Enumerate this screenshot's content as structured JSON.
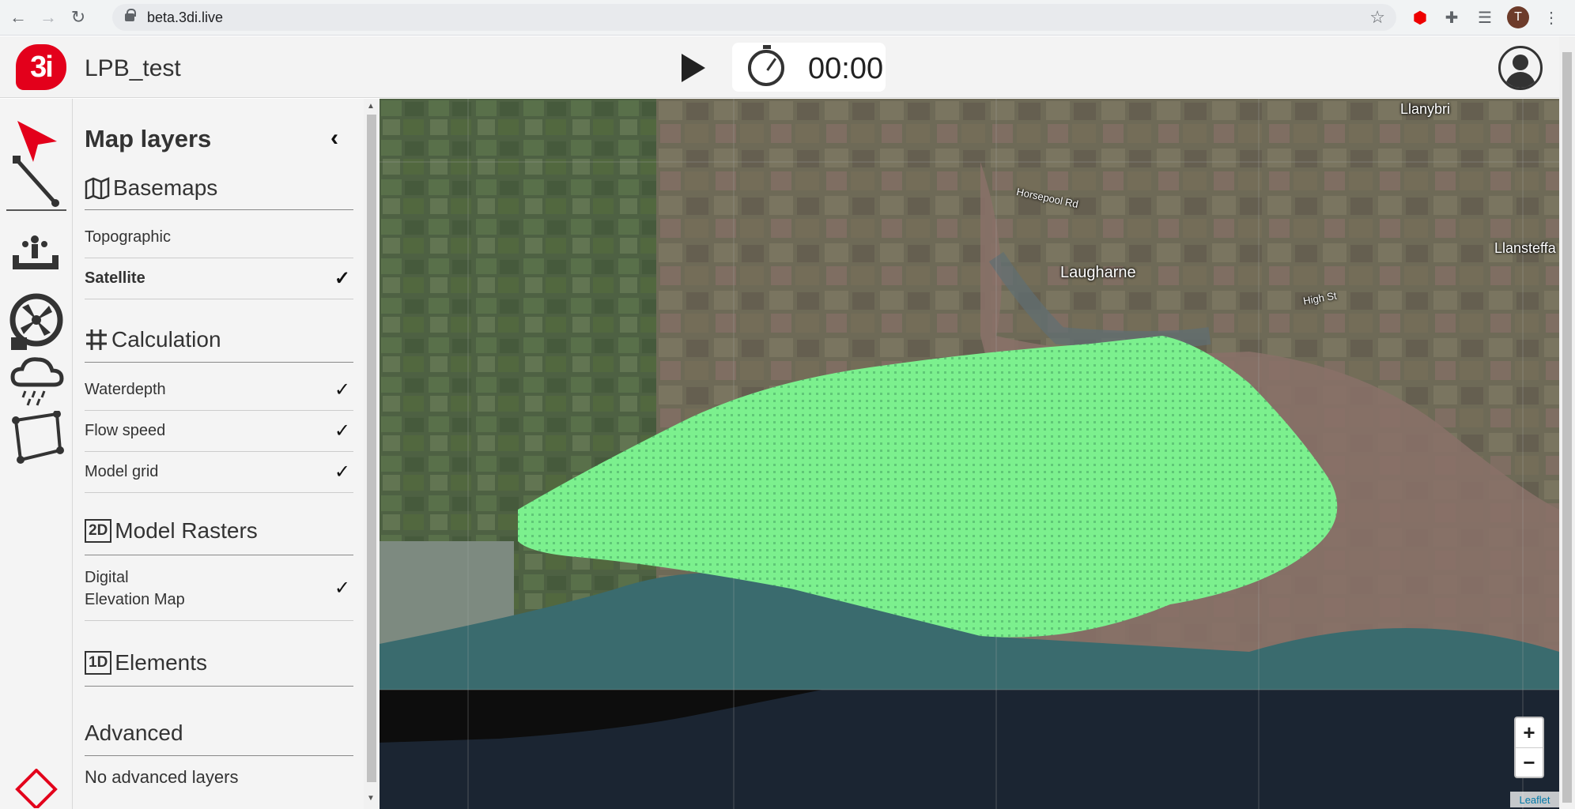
{
  "browser": {
    "url": "beta.3di.live",
    "profile_initial": "T"
  },
  "header": {
    "logo_text": "3i",
    "project_name": "LPB_test",
    "timer": "00:00"
  },
  "panel": {
    "title": "Map layers",
    "collapse_symbol": "‹",
    "sections": {
      "basemaps": {
        "title": "Basemaps",
        "items": [
          {
            "label": "Topographic",
            "checked": false
          },
          {
            "label": "Satellite",
            "checked": true
          }
        ]
      },
      "calculation": {
        "title": "Calculation",
        "items": [
          {
            "label": "Waterdepth",
            "checked": true
          },
          {
            "label": "Flow speed",
            "checked": true
          },
          {
            "label": "Model grid",
            "checked": true
          }
        ]
      },
      "model_rasters": {
        "badge": "2D",
        "title": "Model Rasters",
        "items": [
          {
            "label_line1": "Digital",
            "label_line2": "Elevation Map",
            "checked": true
          }
        ]
      },
      "elements": {
        "badge": "1D",
        "title": "Elements"
      },
      "advanced": {
        "title": "Advanced",
        "empty_text": "No advanced layers"
      }
    },
    "check_symbol": "✓"
  },
  "map": {
    "labels": {
      "llanybri": "Llanybri",
      "horsepool": "Horsepool Rd",
      "laugharne": "Laugharne",
      "high_st": "High St",
      "llansteffan": "Llansteffa"
    },
    "zoom_in": "+",
    "zoom_out": "−",
    "attribution": "Leaflet",
    "grid_color": "#7cf08e"
  }
}
